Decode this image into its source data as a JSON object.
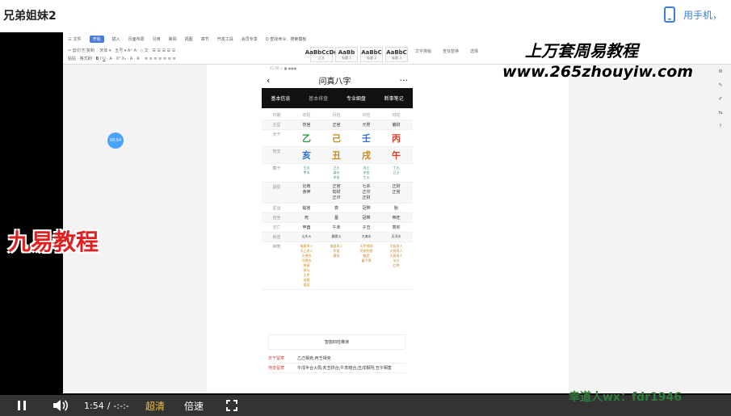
{
  "page": {
    "title": "兄弟姐妹2",
    "phone_link": "用手机，"
  },
  "watermarks": {
    "line1": "上万套周易教程",
    "line2": "www.265zhouyiw.com",
    "brand": "九易教程",
    "contact": "幸道人wx：fdr1946"
  },
  "bubble": "00:54",
  "wps": {
    "menu": [
      "三 文件",
      "开始",
      "插入",
      "页面布局",
      "引用",
      "审阅",
      "视图",
      "章节",
      "开发工具",
      "会员专享",
      "Q 查找命令、搜索模板"
    ],
    "active_menu": "开始",
    "font_name": "宋体",
    "font_size": "五号",
    "styles": [
      {
        "preview": "AaBbCcDd",
        "name": "正文"
      },
      {
        "preview": "AaBb",
        "name": "标题 1"
      },
      {
        "preview": "AaBbC",
        "name": "标题 2"
      },
      {
        "preview": "AaBbC",
        "name": "标题 3"
      }
    ],
    "right_tools": [
      "文字排版",
      "查找替换",
      "选择"
    ]
  },
  "app": {
    "status": "21:56 ☉ ■ ●●●",
    "back": "‹",
    "title": "问真八字",
    "more": "···",
    "tabs": [
      "基本信息",
      "基本排盘",
      "专业细盘",
      "断事笔记"
    ],
    "active_tab": "基本排盘",
    "header": [
      "日期",
      "年柱",
      "月柱",
      "日柱",
      "时柱"
    ],
    "zhuxing": {
      "label": "主星",
      "values": [
        "伤官",
        "正官",
        "元男",
        "偏财"
      ]
    },
    "tiangan": {
      "label": "天干",
      "values": [
        "乙",
        "己",
        "壬",
        "丙"
      ],
      "colors": [
        "#2a9a3c",
        "#c68a1a",
        "#2a6fd6",
        "#d63a2a"
      ]
    },
    "dizhi": {
      "label": "地支",
      "values": [
        "亥",
        "丑",
        "戌",
        "午"
      ],
      "colors": [
        "#2a6fd6",
        "#c68a1a",
        "#c68a1a",
        "#d63a2a"
      ]
    },
    "canggan": {
      "label": "藏干",
      "values": [
        [
          "壬水",
          "甲木"
        ],
        [
          "己土",
          "癸水",
          "辛金"
        ],
        [
          "戊土",
          "辛金",
          "丁火"
        ],
        [
          "丁火",
          "己土"
        ]
      ]
    },
    "fuxing": {
      "label": "副星",
      "values": [
        [
          "比肩",
          "食神"
        ],
        [
          "正官",
          "劫财",
          "正印"
        ],
        [
          "七杀",
          "正印",
          "正财"
        ],
        [
          "正财",
          "正官"
        ]
      ]
    },
    "xingyun": {
      "label": "星运",
      "values": [
        "临官",
        "衰",
        "冠带",
        "胎"
      ]
    },
    "zizuo": {
      "label": "自坐",
      "values": [
        "死",
        "墓",
        "冠带",
        "帝旺"
      ]
    },
    "kongwang": {
      "label": "空亡",
      "values": [
        "申酉",
        "午未",
        "子丑",
        "寅卯"
      ]
    },
    "nayin": {
      "label": "纳音",
      "values": [
        "山头火",
        "霹雳火",
        "大海水",
        "天河水"
      ]
    },
    "shensha": {
      "label": "神煞",
      "values": [
        [
          "福星贵人",
          "天乙贵人",
          "天德合",
          "月德合",
          "将星",
          "驿马",
          "天罗",
          "劫煞",
          "孤辰"
        ],
        [
          "福星贵人",
          "华盖",
          "寡宿"
        ],
        [
          "天罗地网",
          "阴差阳错",
          "魁罡",
          "童子煞"
        ],
        [
          "太极贵人",
          "文昌贵人",
          "天厨贵人",
          "羊刃",
          "红艳"
        ]
      ]
    },
    "button": "智能四柱推演",
    "info": [
      {
        "key": "天干留意",
        "value": "乙己相克;丙壬相克"
      },
      {
        "key": "地支留意",
        "value": "午戌半合火局;亥丑拱合;午亥暗合;丑戌相刑;丑午相害"
      }
    ]
  },
  "player": {
    "time": "1:54",
    "separator": "/",
    "duration": "-:-:-",
    "quality": "超清",
    "speed": "倍速"
  }
}
